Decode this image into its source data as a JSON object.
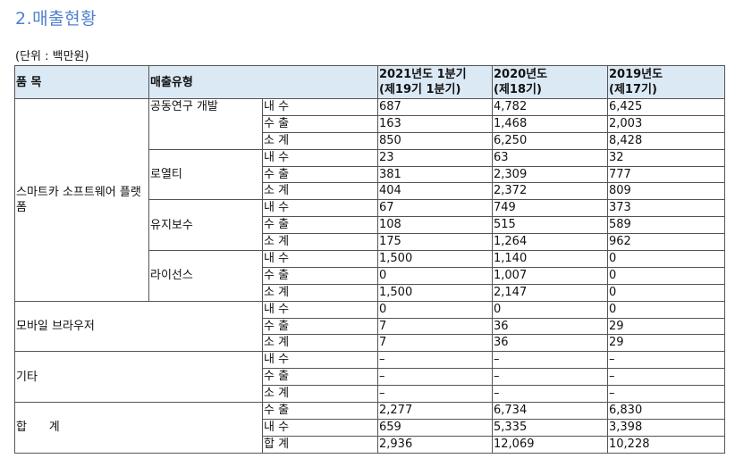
{
  "title": "2.매출현황",
  "unit": "(단위 : 백만원)",
  "headers": {
    "product": "품   목",
    "sales_type": "매출유형",
    "col1_line1": "2021년도 1분기",
    "col1_line2": "(제19기 1분기)",
    "col2_line1": "2020년도",
    "col2_line2": "(제18기)",
    "col3_line1": "2019년도",
    "col3_line2": "(제17기)"
  },
  "groups": {
    "smartcar": {
      "name": "스마트카 소프트웨어 플랫폼",
      "sub": {
        "joint": {
          "name": "공동연구 개발",
          "rows": [
            {
              "type": "내 수",
              "v1": "687",
              "v2": "4,782",
              "v3": "6,425"
            },
            {
              "type": "수 출",
              "v1": "163",
              "v2": "1,468",
              "v3": "2,003"
            },
            {
              "type": "소 계",
              "v1": "850",
              "v2": "6,250",
              "v3": "8,428"
            }
          ]
        },
        "royalty": {
          "name": "로열티",
          "rows": [
            {
              "type": "내 수",
              "v1": "23",
              "v2": "63",
              "v3": "32"
            },
            {
              "type": "수 출",
              "v1": "381",
              "v2": "2,309",
              "v3": "777"
            },
            {
              "type": "소 계",
              "v1": "404",
              "v2": "2,372",
              "v3": "809"
            }
          ]
        },
        "maintenance": {
          "name": "유지보수",
          "rows": [
            {
              "type": "내 수",
              "v1": "67",
              "v2": "749",
              "v3": "373"
            },
            {
              "type": "수 출",
              "v1": "108",
              "v2": "515",
              "v3": "589"
            },
            {
              "type": "소 계",
              "v1": "175",
              "v2": "1,264",
              "v3": "962"
            }
          ]
        },
        "license": {
          "name": "라이선스",
          "rows": [
            {
              "type": "내 수",
              "v1": "1,500",
              "v2": "1,140",
              "v3": "0"
            },
            {
              "type": "수 출",
              "v1": "0",
              "v2": "1,007",
              "v3": "0"
            },
            {
              "type": "소 계",
              "v1": "1,500",
              "v2": "2,147",
              "v3": "0"
            }
          ]
        }
      }
    },
    "mobile": {
      "name": "모바일 브라우저",
      "rows": [
        {
          "type": "내 수",
          "v1": "0",
          "v2": "0",
          "v3": "0"
        },
        {
          "type": "수 출",
          "v1": "7",
          "v2": "36",
          "v3": "29"
        },
        {
          "type": "소 계",
          "v1": "7",
          "v2": "36",
          "v3": "29"
        }
      ]
    },
    "other": {
      "name": "기타",
      "rows": [
        {
          "type": "내 수",
          "v1": "–",
          "v2": "–",
          "v3": "–"
        },
        {
          "type": "수 출",
          "v1": "–",
          "v2": "–",
          "v3": "–"
        },
        {
          "type": "소 계",
          "v1": "–",
          "v2": "–",
          "v3": "–"
        }
      ]
    },
    "total": {
      "name": "합      계",
      "rows": [
        {
          "type": "수 출",
          "v1": "2,277",
          "v2": "6,734",
          "v3": "6,830"
        },
        {
          "type": "내 수",
          "v1": "659",
          "v2": "5,335",
          "v3": "3,398"
        },
        {
          "type": "합 계",
          "v1": "2,936",
          "v2": "12,069",
          "v3": "10,228"
        }
      ]
    }
  }
}
